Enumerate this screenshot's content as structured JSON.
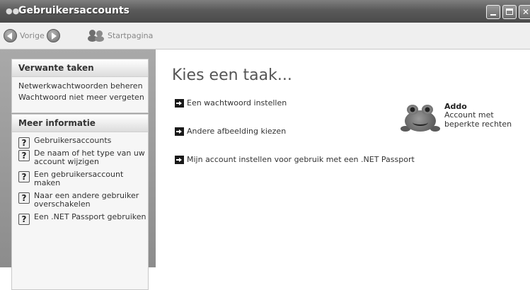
{
  "window": {
    "title": "Gebruikersaccounts",
    "controls": [
      "minimize",
      "maximize",
      "close"
    ]
  },
  "toolbar": {
    "back_label": "Vorige",
    "home_label": "Startpagina"
  },
  "sidebar": {
    "related_tasks": {
      "title": "Verwante taken",
      "items": [
        {
          "label": "Netwerkwachtwoorden beheren"
        },
        {
          "label": "Wachtwoord niet meer vergeten"
        }
      ]
    },
    "more_info": {
      "title": "Meer informatie",
      "items": [
        {
          "label": "Gebruikersaccounts"
        },
        {
          "label": "De naam of het type van uw account wijzigen"
        },
        {
          "label": "Een gebruikersaccount maken"
        },
        {
          "label": "Naar een andere gebruiker overschakelen"
        },
        {
          "label": "Een .NET Passport gebruiken"
        }
      ]
    }
  },
  "main": {
    "title": "Kies een taak...",
    "tasks": [
      {
        "label": "Een wachtwoord instellen"
      },
      {
        "label": "Andere afbeelding kiezen"
      },
      {
        "label": "Mijn account instellen voor gebruik met een .NET Passport"
      }
    ]
  },
  "account": {
    "name": "Addo",
    "type": "Account met beperkte rechten",
    "avatar_icon": "frog-icon"
  }
}
